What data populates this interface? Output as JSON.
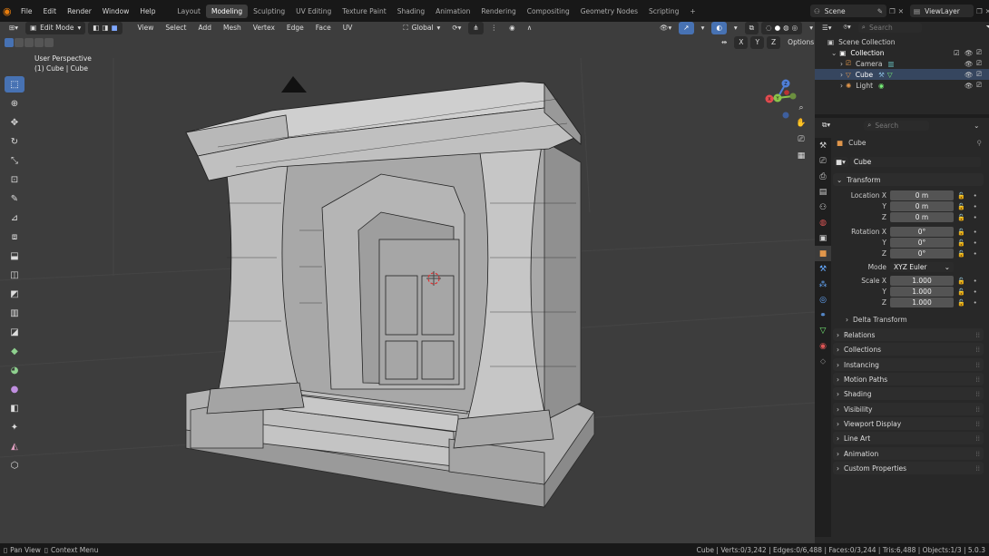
{
  "top_menu": {
    "items": [
      "File",
      "Edit",
      "Render",
      "Window",
      "Help"
    ],
    "workspaces": [
      "Layout",
      "Modeling",
      "Sculpting",
      "UV Editing",
      "Texture Paint",
      "Shading",
      "Animation",
      "Rendering",
      "Compositing",
      "Geometry Nodes",
      "Scripting"
    ],
    "active_workspace": "Modeling",
    "add_tab": "+",
    "scene_label": "Scene",
    "view_layer_label": "ViewLayer"
  },
  "viewport_header": {
    "mode": "Edit Mode",
    "menus": [
      "View",
      "Select",
      "Add",
      "Mesh",
      "Vertex",
      "Edge",
      "Face",
      "UV"
    ],
    "transform_orientation": "Global",
    "axis_labels": [
      "X",
      "Y",
      "Z"
    ],
    "options_label": "Options",
    "search_placeholder": "Search"
  },
  "viewport": {
    "perspective": "User Perspective",
    "object_info": "(1) Cube | Cube",
    "gizmo_axes": {
      "x": "X",
      "y": "Y",
      "z": "Z"
    },
    "colors": {
      "x": "#e34b4f",
      "y": "#8bc34a",
      "z": "#4f7fd8"
    }
  },
  "outliner": {
    "search_placeholder": "Search",
    "root": "Scene Collection",
    "collection": "Collection",
    "objects": [
      "Camera",
      "Cube",
      "Light"
    ]
  },
  "properties": {
    "search_placeholder": "Search",
    "object_name": "Cube",
    "object_field": "Cube",
    "transform_label": "Transform",
    "location": {
      "label_x": "Location X",
      "x": "0 m",
      "y": "0 m",
      "z": "0 m"
    },
    "rotation": {
      "label_x": "Rotation X",
      "x": "0°",
      "y": "0°",
      "z": "0°"
    },
    "mode_label": "Mode",
    "mode_value": "XYZ Euler",
    "scale": {
      "label_x": "Scale X",
      "x": "1.000",
      "y": "1.000",
      "z": "1.000"
    },
    "axis_y": "Y",
    "axis_z": "Z",
    "delta_transform": "Delta Transform",
    "panels": [
      "Relations",
      "Collections",
      "Instancing",
      "Motion Paths",
      "Shading",
      "Visibility",
      "Viewport Display",
      "Line Art",
      "Animation",
      "Custom Properties"
    ]
  },
  "statusbar": {
    "pan_view": "Pan View",
    "context_menu": "Context Menu",
    "stats": "Cube | Verts:0/3,242 | Edges:0/6,488 | Faces:0/3,244 | Tris:6,488 | Objects:1/3 | 5.0.3"
  }
}
